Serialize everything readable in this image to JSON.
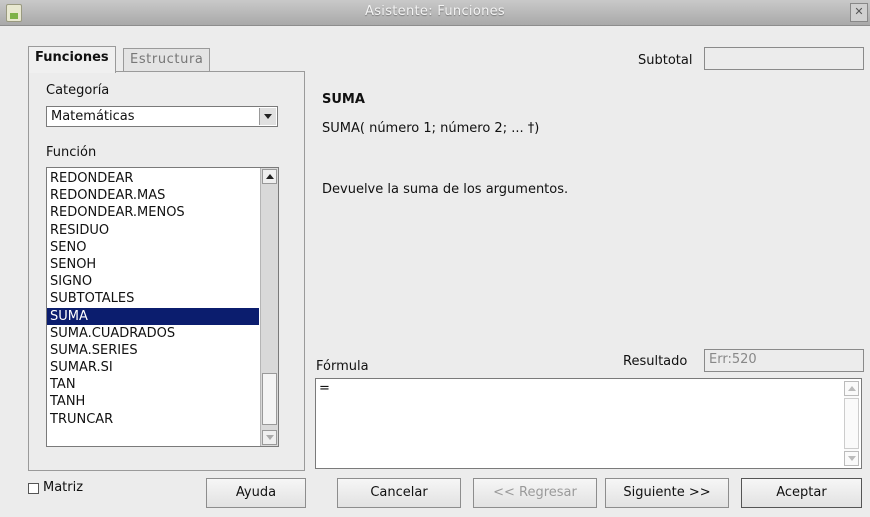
{
  "window": {
    "title": "Asistente: Funciones"
  },
  "tabs": [
    {
      "label": "Funciones"
    },
    {
      "label": "Estructura"
    }
  ],
  "subtotal": {
    "label": "Subtotal",
    "value": ""
  },
  "category": {
    "label": "Categoría",
    "value": "Matemáticas"
  },
  "function": {
    "label": "Función",
    "items": [
      "REDONDEAR",
      "REDONDEAR.MAS",
      "REDONDEAR.MENOS",
      "RESIDUO",
      "SENO",
      "SENOH",
      "SIGNO",
      "SUBTOTALES",
      "SUMA",
      "SUMA.CUADRADOS",
      "SUMA.SERIES",
      "SUMAR.SI",
      "TAN",
      "TANH",
      "TRUNCAR"
    ],
    "selected": "SUMA"
  },
  "details": {
    "name": "SUMA",
    "syntax": "SUMA( número 1; número 2; ... †)",
    "description": "Devuelve la suma de los argumentos."
  },
  "formula": {
    "label": "Fórmula",
    "value": "="
  },
  "result": {
    "label": "Resultado",
    "value": "Err:520"
  },
  "matrix": {
    "label": "Matriz",
    "checked": false
  },
  "buttons": {
    "help": "Ayuda",
    "cancel": "Cancelar",
    "back": "<< Regresar",
    "next": "Siguiente >>",
    "accept": "Aceptar"
  },
  "colors": {
    "selection": "#0b1d6e",
    "title_bar": "#b8b8b8"
  }
}
